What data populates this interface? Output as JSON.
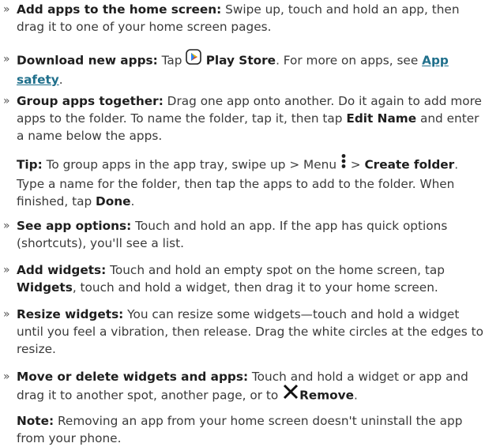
{
  "items": [
    {
      "bullet": "»",
      "label": "Add apps to the home screen:",
      "text": " Swipe up, touch and hold an app, then drag it to one of your home screen pages."
    },
    {
      "bullet": "»",
      "label": "Download new apps:",
      "text_a": " Tap ",
      "icon": "play-store-icon",
      "bold_b": " Play Store",
      "text_c": ". For more on apps, see ",
      "link": "App safety",
      "text_d": "."
    },
    {
      "bullet": "»",
      "label": "Group apps together:",
      "text_a": " Drag one app onto another. Do it again to add more apps to the folder. To name the folder, tap it, then tap ",
      "bold_b": "Edit Name",
      "text_c": " and enter a name below the apps."
    },
    {
      "label": "Tip:",
      "text_a": " To group apps in the app tray, swipe up > Menu ",
      "icon": "menu-dots-icon",
      "text_b": " > ",
      "bold_c": "Create folder",
      "text_d": ". Type a name for the folder, then tap the apps to add to the folder. When finished, tap ",
      "bold_e": "Done",
      "text_f": "."
    },
    {
      "bullet": "»",
      "label": "See app options:",
      "text": " Touch and hold an app. If the app has quick options (shortcuts), you'll see a list."
    },
    {
      "bullet": "»",
      "label": "Add widgets:",
      "text_a": " Touch and hold an empty spot on the home screen, tap ",
      "bold_b": "Widgets",
      "text_c": ", touch and hold a widget, then drag it to your home screen."
    },
    {
      "bullet": "»",
      "label": "Resize widgets:",
      "text": " You can resize some widgets—touch and hold a widget until you feel a vibration, then release. Drag the white circles at the edges to resize."
    },
    {
      "bullet": "»",
      "label": "Move or delete widgets and apps:",
      "text_a": " Touch and hold a widget or app and drag it to another spot, another page, or to ",
      "icon": "close-icon",
      "bold_b": "Remove",
      "text_c": "."
    },
    {
      "label": "Note:",
      "text": " Removing an app from your home screen doesn't uninstall the app from your phone."
    }
  ],
  "colors": {
    "text": "#3a3a3a",
    "bold": "#1e1e1e",
    "link": "#1f6f8b"
  }
}
